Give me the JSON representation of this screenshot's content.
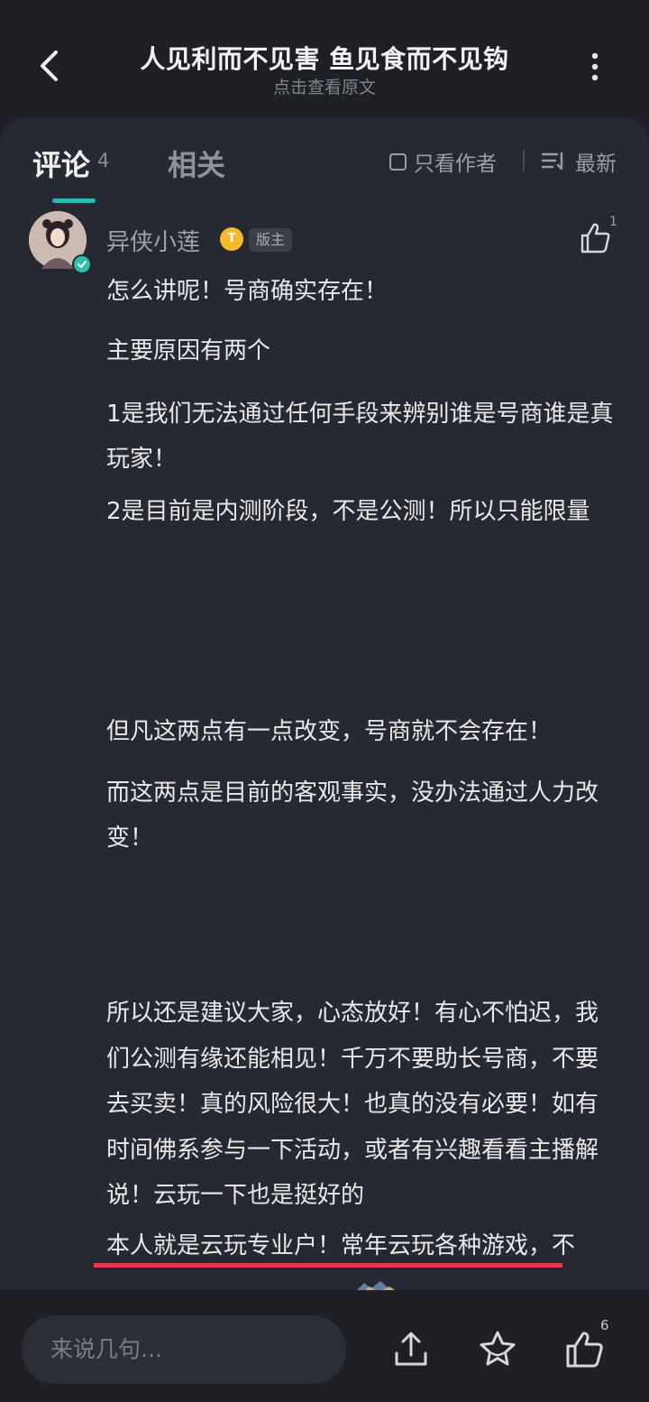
{
  "header": {
    "title": "人见利而不见害 鱼见食而不见钩",
    "subtitle": "点击查看原文"
  },
  "tabs": {
    "comments_label": "评论",
    "comments_count": "4",
    "related_label": "相关",
    "author_only_label": "只看作者",
    "sort_label": "最新"
  },
  "comment": {
    "username": "异侠小莲",
    "level_badge": "T",
    "role_badge": "版主",
    "like_count": "1",
    "lines": [
      "怎么讲呢！号商确实存在！",
      "主要原因有两个",
      "1是我们无法通过任何手段来辨别谁是号商谁是真玩家！",
      "2是目前是内测阶段，不是公测！所以只能限量",
      "但凡这两点有一点改变，号商就不会存在！",
      "而这两点是目前的客观事实，没办法通过人力改变！",
      "所以还是建议大家，心态放好！有心不怕迟，我们公测有缘还能相见！千万不要助长号商，不要去买卖！真的风险很大！也真的没有必要！如有时间佛系参与一下活动，或者有兴趣看看主播解说！云玩一下也是挺好的",
      "本人就是云玩专业户！常年云玩各种游戏，不"
    ]
  },
  "bottom_bar": {
    "input_placeholder": "来说几句...",
    "like_count": "6"
  },
  "colors": {
    "background": "#1e2026",
    "panel": "#262931",
    "accent": "#29b8b6",
    "highlight_underline": "#e5384a"
  }
}
